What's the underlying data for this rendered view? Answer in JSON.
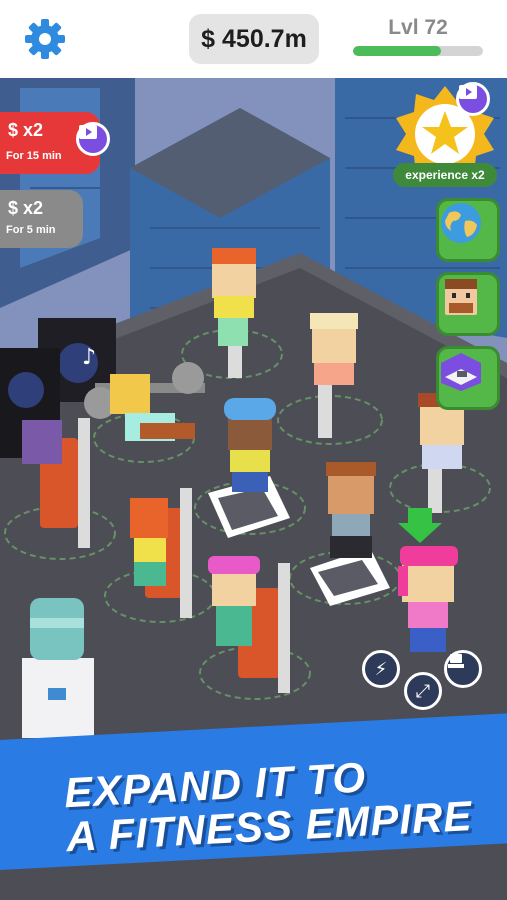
{
  "topbar": {
    "settings_icon": "gear-icon",
    "money": "$ 450.7m",
    "level_label": "Lvl 72",
    "level_progress": 0.68
  },
  "boosts": [
    {
      "amount": "$ x2",
      "duration": "For 15 min",
      "color": "#e63838",
      "icon": "video-icon"
    },
    {
      "amount": "$ x2",
      "duration": "For 5 min",
      "color": "#8a8a8a"
    }
  ],
  "experience": {
    "label": "experience x2",
    "icon": "star-icon",
    "video_icon": "video-icon"
  },
  "side_buttons": [
    {
      "name": "world-map",
      "icon": "globe-icon"
    },
    {
      "name": "staff",
      "icon": "trainer-face-icon"
    },
    {
      "name": "room",
      "icon": "room-icon"
    }
  ],
  "actions": [
    {
      "name": "energy",
      "icon": "lightning-icon"
    },
    {
      "name": "move",
      "icon": "arrows-icon"
    },
    {
      "name": "machine",
      "icon": "treadmill-icon"
    }
  ],
  "banner": {
    "line1": "EXPAND IT TO",
    "line2": "A FITNESS EMPIRE"
  },
  "colors": {
    "accent_green": "#53b848",
    "banner_blue": "#2a7be4",
    "boost_red": "#e63838"
  }
}
